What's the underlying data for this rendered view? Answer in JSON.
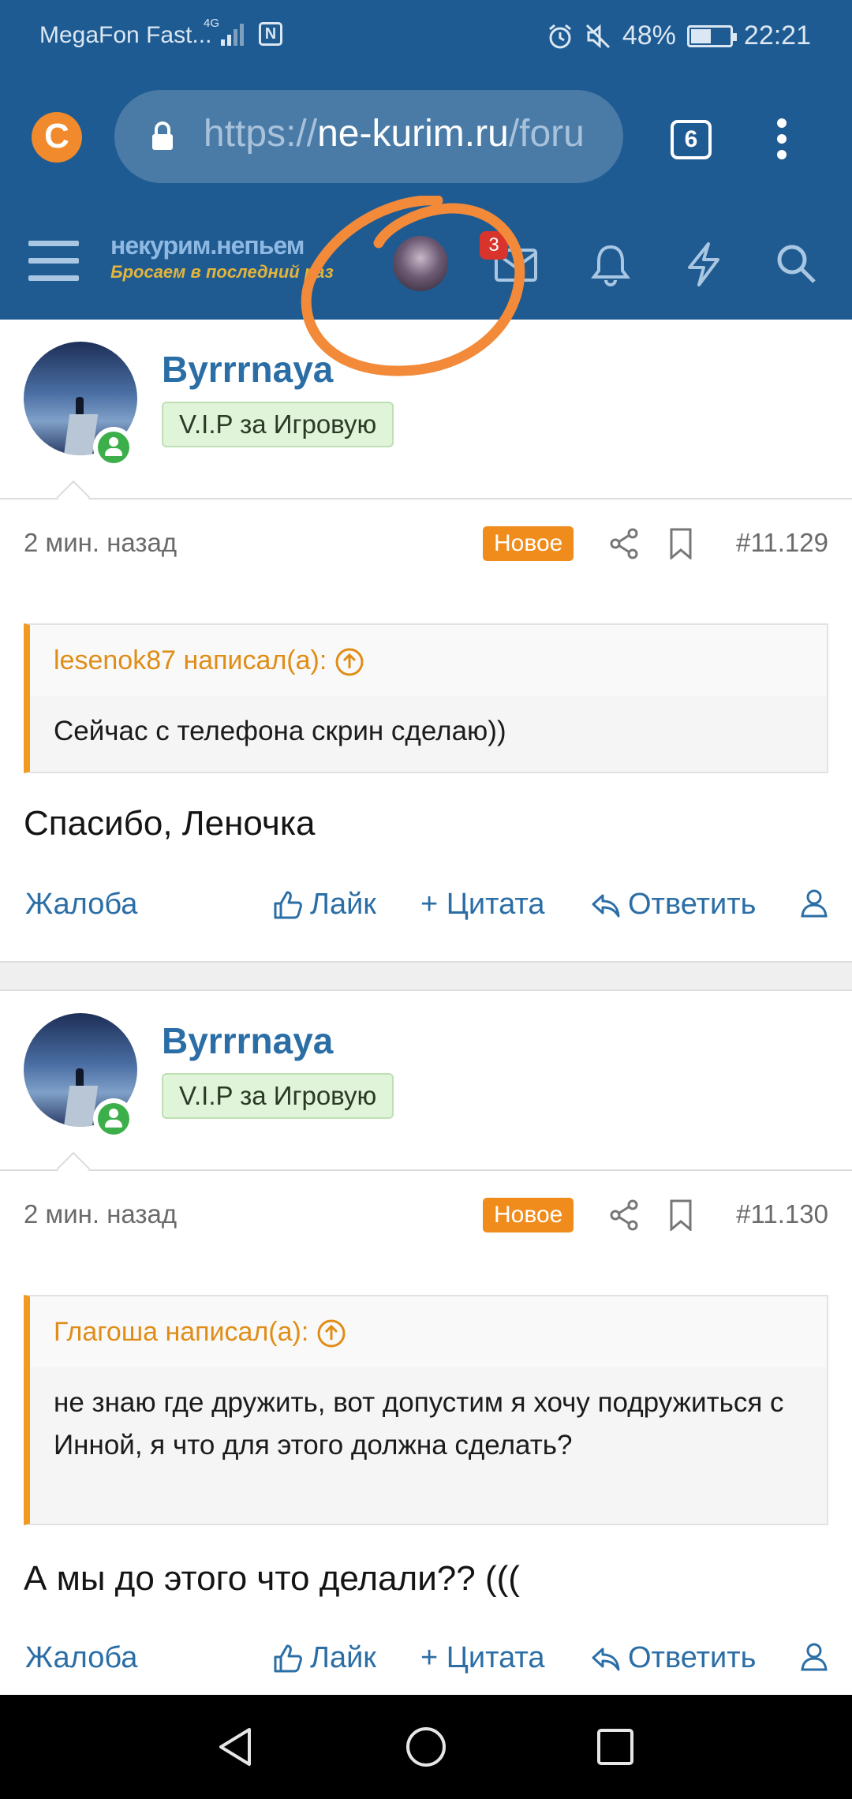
{
  "status": {
    "carrier": "MegaFon Fast...",
    "network": "4G",
    "battery": "48%",
    "battery_level": 0.48,
    "time": "22:21"
  },
  "browser": {
    "url_scheme": "https://",
    "url_host": "ne-kurim.ru",
    "url_path": "/foru",
    "tab_count": "6"
  },
  "site": {
    "logo_line1": "некурим.непьем",
    "logo_line2": "Бросаем в последний раз",
    "notif_badge": "3"
  },
  "posts": [
    {
      "author": "Byrrrnaya",
      "role": "V.I.P за Игровую",
      "time": "2 мин. назад",
      "new_tag": "Новое",
      "number": "#11.129",
      "quote_author": "lesenok87 написал(а):",
      "quote_text": "Сейчас с телефона скрин сделаю))",
      "message": "Спасибо, Леночка",
      "actions": {
        "report": "Жалоба",
        "like": "Лайк",
        "quote": "+ Цитата",
        "reply": "Ответить"
      }
    },
    {
      "author": "Byrrrnaya",
      "role": "V.I.P за Игровую",
      "time": "2 мин. назад",
      "new_tag": "Новое",
      "number": "#11.130",
      "quote_author": "Глагоша написал(а):",
      "quote_text": "не знаю где дружить, вот допустим я хочу подружиться с Инной, я что для этого должна сделать?",
      "message": "А мы до этого что делали?? (((",
      "actions": {
        "report": "Жалоба",
        "like": "Лайк",
        "quote": "+ Цитата",
        "reply": "Ответить"
      }
    }
  ],
  "colors": {
    "header": "#1f5b91",
    "link": "#2b6ea6",
    "accent": "#f08c1c",
    "online": "#3cae4a",
    "annotation": "#f28a3a"
  }
}
